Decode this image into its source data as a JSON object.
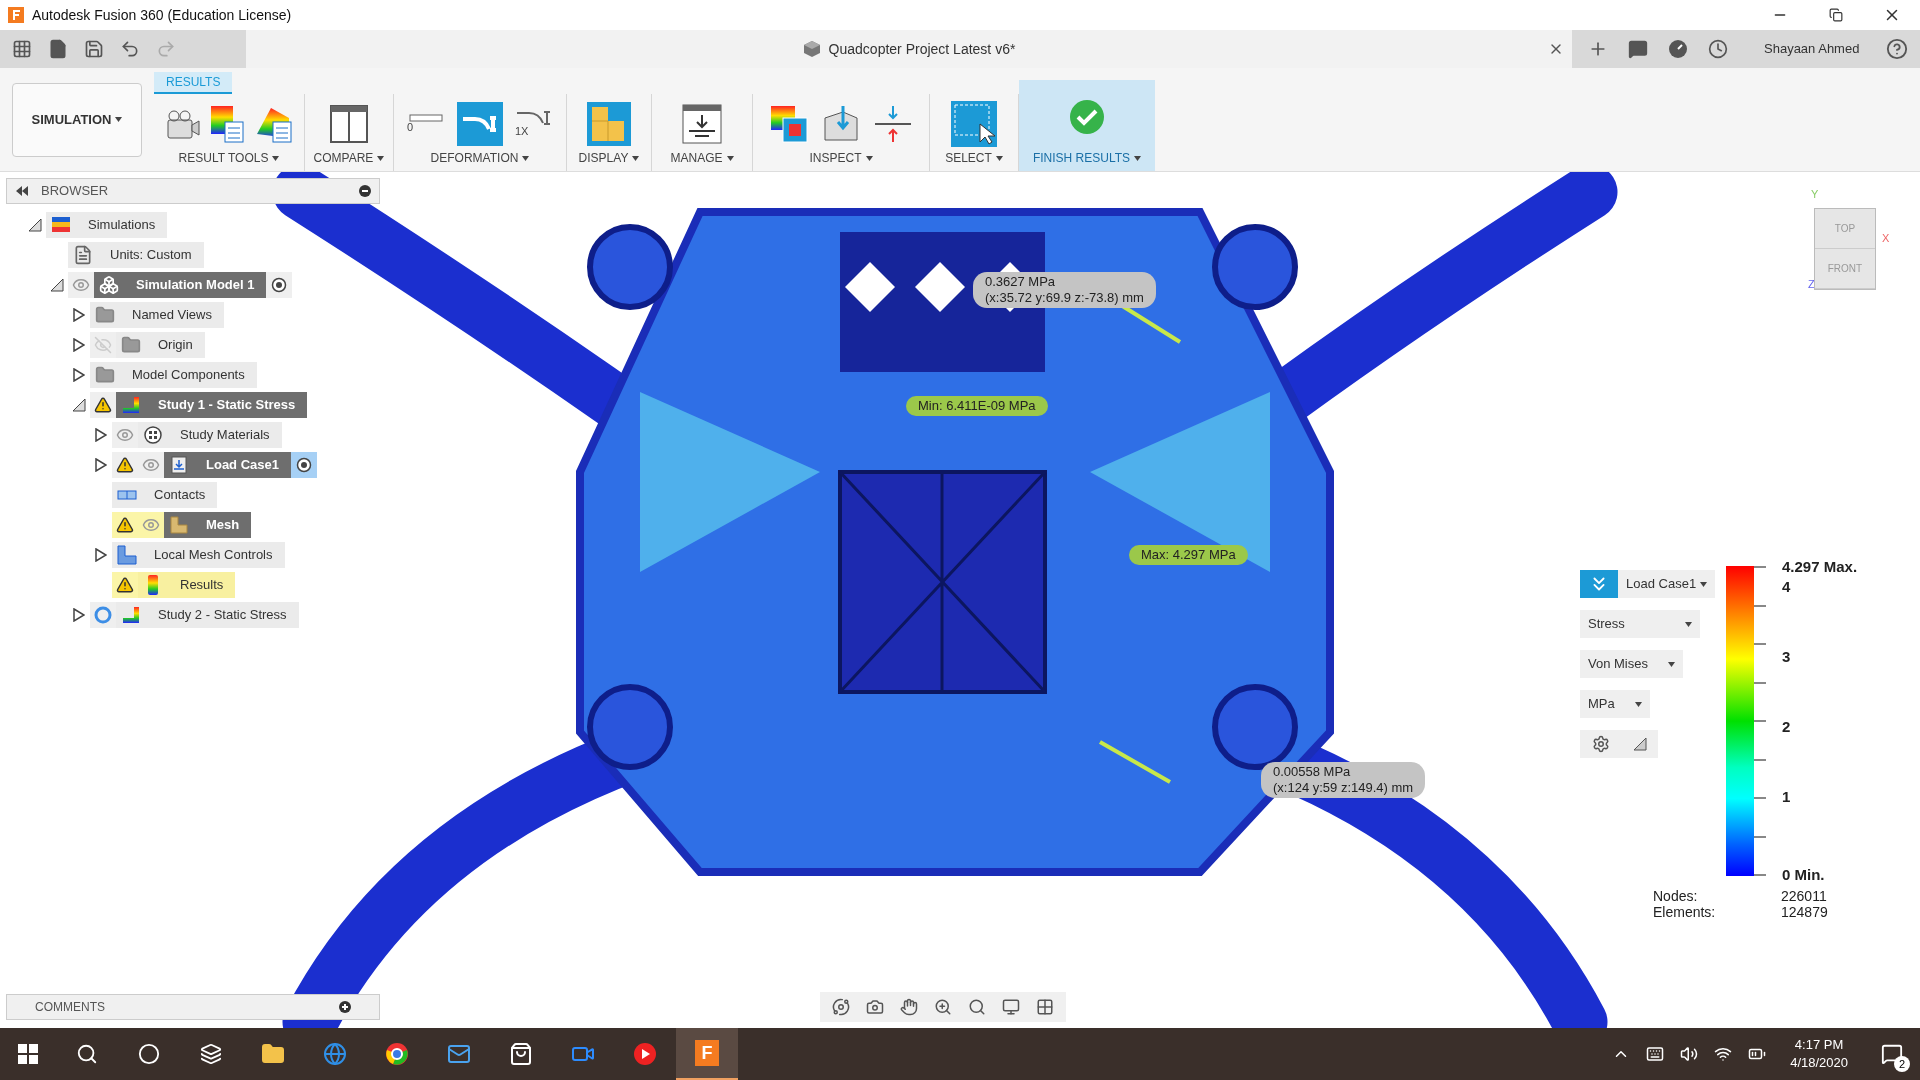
{
  "window": {
    "title": "Autodesk Fusion 360 (Education License)"
  },
  "document_tab": {
    "title": "Quadcopter Project Latest v6*"
  },
  "user": {
    "name": "Shayaan Ahmed"
  },
  "ribbon": {
    "workspace": "SIMULATION",
    "tabs": [
      {
        "label": "RESULTS",
        "selected": true
      }
    ],
    "groups": [
      {
        "kind": "result_tools",
        "label": "RESULT TOOLS",
        "highlighted": false
      },
      {
        "kind": "compare",
        "label": "COMPARE",
        "highlighted": false
      },
      {
        "kind": "deformation",
        "label": "DEFORMATION",
        "highlighted": false,
        "tools": [
          {
            "text": "0",
            "selected": false
          },
          {
            "selected": true
          },
          {
            "text": "1X",
            "selected": false
          }
        ]
      },
      {
        "kind": "display",
        "label": "DISPLAY",
        "highlighted": false
      },
      {
        "kind": "manage",
        "label": "MANAGE",
        "highlighted": false
      },
      {
        "kind": "inspect",
        "label": "INSPECT",
        "highlighted": false
      },
      {
        "kind": "select",
        "label": "SELECT",
        "highlighted": false
      },
      {
        "kind": "finish",
        "label": "FINISH RESULTS",
        "highlighted": true
      }
    ]
  },
  "browser": {
    "title": "BROWSER",
    "tree": [
      {
        "label": "Simulations",
        "kind": "simulations",
        "expanded": true,
        "active": false,
        "flagged": false,
        "children": [
          {
            "label": "Units: Custom",
            "kind": "document",
            "active": false,
            "flagged": false
          },
          {
            "label": "Simulation Model 1",
            "kind": "model",
            "expanded": true,
            "visible": true,
            "active": true,
            "flagged": false,
            "radio_highlighted": false,
            "children": [
              {
                "label": "Named Views",
                "kind": "folder",
                "expanded": false,
                "active": false,
                "flagged": false
              },
              {
                "label": "Origin",
                "kind": "folder",
                "expanded": false,
                "visible": false,
                "active": false,
                "flagged": false
              },
              {
                "label": "Model Components",
                "kind": "folder",
                "expanded": false,
                "active": false,
                "flagged": false
              },
              {
                "label": "Study 1 - Static Stress",
                "kind": "study",
                "expanded": true,
                "warning": true,
                "active": true,
                "flagged": false,
                "children": [
                  {
                    "label": "Study Materials",
                    "kind": "materials",
                    "expanded": false,
                    "visible": true,
                    "active": false,
                    "flagged": false
                  },
                  {
                    "label": "Load Case1",
                    "kind": "load",
                    "expanded": false,
                    "visible": true,
                    "warning": true,
                    "active": true,
                    "flagged": false,
                    "radio_highlighted": true
                  },
                  {
                    "label": "Contacts",
                    "kind": "contacts",
                    "active": false,
                    "flagged": false
                  },
                  {
                    "label": "Mesh",
                    "kind": "mesh",
                    "visible": true,
                    "warning": true,
                    "active": true,
                    "flagged": true
                  },
                  {
                    "label": "Local Mesh Controls",
                    "kind": "mesh_controls",
                    "expanded": false,
                    "active": false,
                    "flagged": false
                  },
                  {
                    "label": "Results",
                    "kind": "results",
                    "warning": true,
                    "active": false,
                    "flagged": true
                  }
                ]
              },
              {
                "label": "Study 2 - Static Stress",
                "kind": "study",
                "expanded": false,
                "loading": true,
                "active": false,
                "flagged": false
              }
            ]
          }
        ]
      }
    ]
  },
  "probes": [
    {
      "kind": "probe",
      "lines": [
        "0.3627 MPa",
        "(x:35.72 y:69.9 z:-73.8) mm"
      ]
    },
    {
      "kind": "extreme",
      "lines": [
        "Min: 6.411E-09 MPa"
      ]
    },
    {
      "kind": "extreme",
      "lines": [
        "Max: 4.297 MPa"
      ]
    },
    {
      "kind": "probe",
      "lines": [
        "0.00558 MPa",
        "(x:124 y:59 z:149.4) mm"
      ]
    }
  ],
  "view_cube": {
    "faces": [
      "TOP",
      "FRONT"
    ],
    "axes": [
      "Y",
      "X",
      "Z"
    ]
  },
  "legend": {
    "load_case": "Load Case1",
    "dropdowns": [
      "Stress",
      "Von Mises",
      "MPa"
    ],
    "max_label": "4.297 Max.",
    "ticks": [
      "4",
      "3",
      "2",
      "1"
    ],
    "min_label": "0 Min.",
    "stats": [
      {
        "label": "Nodes:",
        "value": "226011"
      },
      {
        "label": "Elements:",
        "value": "124879"
      }
    ]
  },
  "comments": {
    "title": "COMMENTS"
  },
  "taskbar": {
    "apps": [
      {
        "kind": "explorer",
        "active": false
      },
      {
        "kind": "edge",
        "active": false
      },
      {
        "kind": "chrome",
        "active": false
      },
      {
        "kind": "mail",
        "active": false
      },
      {
        "kind": "store",
        "active": false
      },
      {
        "kind": "zoom",
        "active": false
      },
      {
        "kind": "player",
        "active": false
      },
      {
        "kind": "fusion",
        "active": true,
        "text": "F"
      }
    ],
    "time": "4:17 PM",
    "date": "4/18/2020",
    "notifications": "2"
  }
}
